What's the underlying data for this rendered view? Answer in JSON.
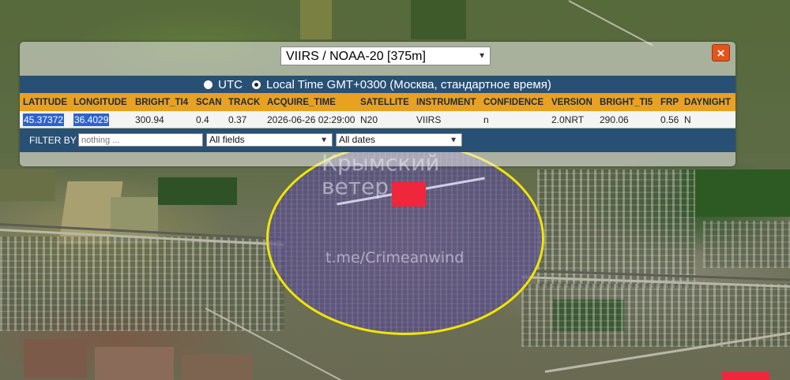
{
  "popup": {
    "source_select": "VIIRS / NOAA-20 [375m]",
    "close_label": "×",
    "time_options": [
      {
        "label": "UTC",
        "selected": false
      },
      {
        "label": "Local Time GMT+0300 (Москва, стандартное время)",
        "selected": true
      }
    ],
    "table": {
      "columns": [
        "LATITUDE",
        "LONGITUDE",
        "BRIGHT_TI4",
        "SCAN",
        "TRACK",
        "ACQUIRE_TIME",
        "SATELLITE",
        "INSTRUMENT",
        "CONFIDENCE",
        "VERSION",
        "BRIGHT_TI5",
        "FRP",
        "DAYNIGHT"
      ],
      "rows": [
        [
          "45.37372",
          "36.4029",
          "300.94",
          "0.4",
          "0.37",
          "2026-06-26 02:29:00",
          "N20",
          "VIIRS",
          "n",
          "2.0NRT",
          "290.06",
          "0.56",
          "N"
        ]
      ]
    },
    "filter": {
      "label": "FILTER BY",
      "placeholder": "nothing ...",
      "field_select": "All fields",
      "date_select": "All dates"
    }
  },
  "watermark": {
    "line1": "Крымский",
    "line2": "ветер",
    "channel": "t.me/Crimeanwind"
  },
  "colors": {
    "header_bar": "#285075",
    "column_header": "#e9a120",
    "close_button": "#e4541b",
    "hotspot": "#f0263c",
    "circle": "#f2e600"
  }
}
